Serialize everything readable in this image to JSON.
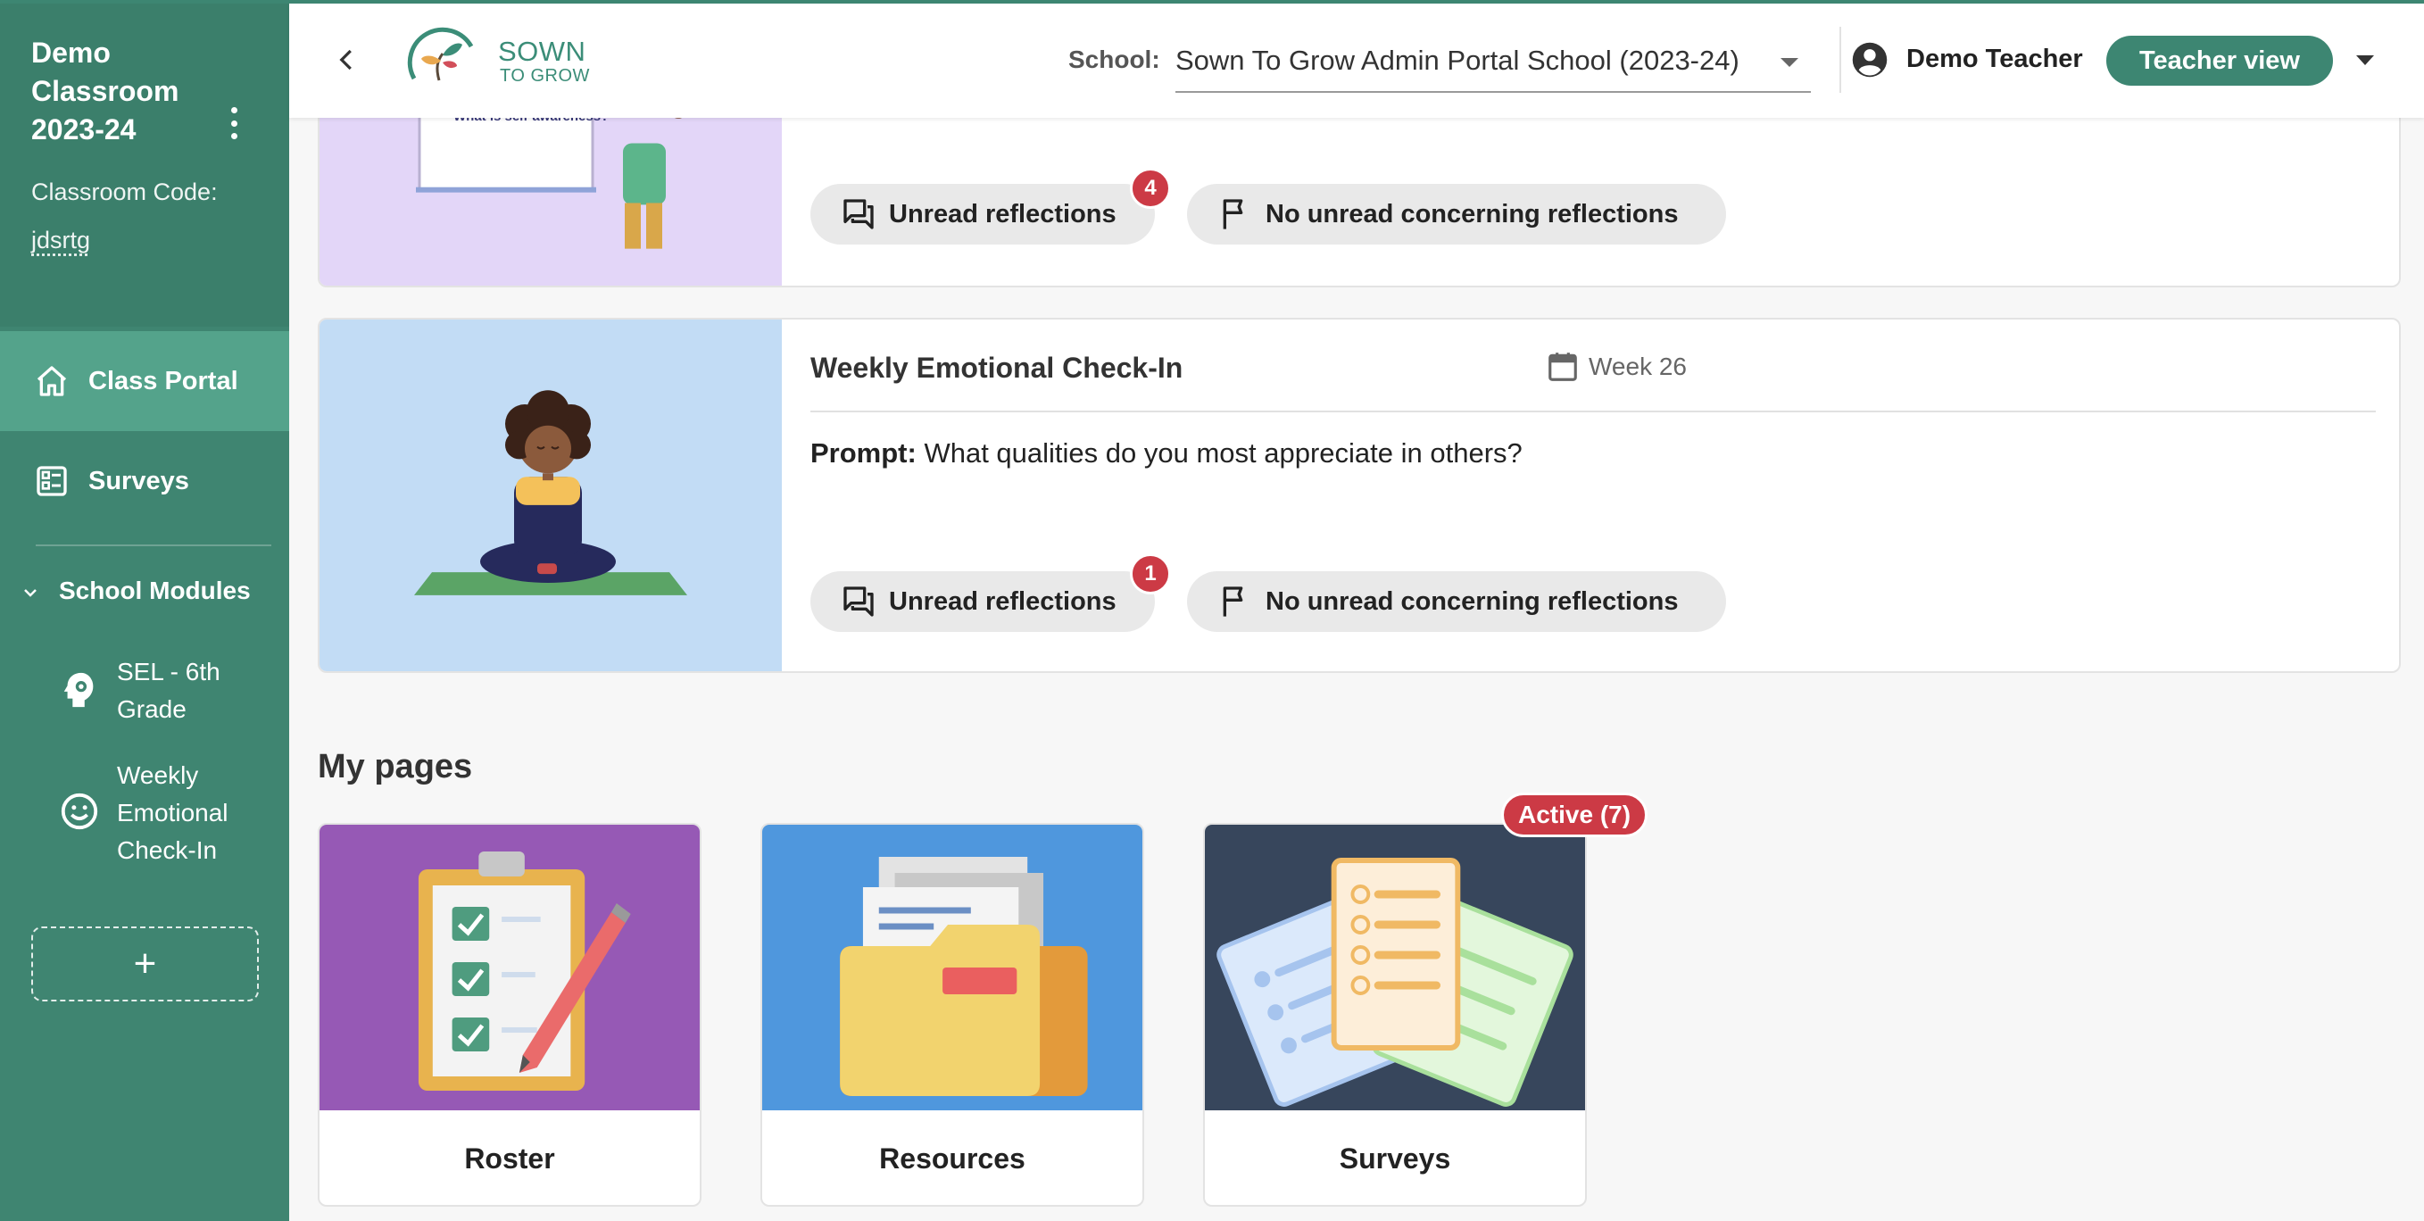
{
  "sidebar": {
    "classroom_title": "Demo Classroom 2023-24",
    "code_label": "Classroom Code:",
    "code_value": "jdsrtg",
    "nav": [
      {
        "label": "Class Portal",
        "icon": "home-icon",
        "active": true
      },
      {
        "label": "Surveys",
        "icon": "survey-icon",
        "active": false
      }
    ],
    "modules_label": "School Modules",
    "modules": [
      {
        "label": "SEL - 6th Grade",
        "icon": "head-gear-icon"
      },
      {
        "label": "Weekly Emotional Check-In",
        "icon": "smile-icon"
      }
    ],
    "add_label": "+"
  },
  "header": {
    "logo_line1": "SOWN",
    "logo_line2": "TO GROW",
    "school_label": "School:",
    "school_value": "Sown To Grow Admin Portal School (2023-24)",
    "user_name": "Demo Teacher",
    "view_button": "Teacher view"
  },
  "cards": [
    {
      "art_caption": "What is self-awareness?",
      "chips": {
        "unread_label": "Unread reflections",
        "unread_count": "4",
        "concern_label": "No unread concerning reflections"
      }
    },
    {
      "title": "Weekly Emotional Check-In",
      "week": "Week 26",
      "prompt_label": "Prompt:",
      "prompt_text": "What qualities do you most appreciate in others?",
      "chips": {
        "unread_label": "Unread reflections",
        "unread_count": "1",
        "concern_label": "No unread concerning reflections"
      }
    }
  ],
  "my_pages": {
    "title": "My pages",
    "active_badge": "Active (7)",
    "tiles": [
      {
        "label": "Roster",
        "color": "#9659b5"
      },
      {
        "label": "Resources",
        "color": "#4f97dd"
      },
      {
        "label": "Surveys",
        "color": "#37465c"
      }
    ]
  },
  "colors": {
    "brand": "#3d8672",
    "sidebar": "#3f8571",
    "active_nav": "#54a38b",
    "badge": "#cc3a45"
  }
}
